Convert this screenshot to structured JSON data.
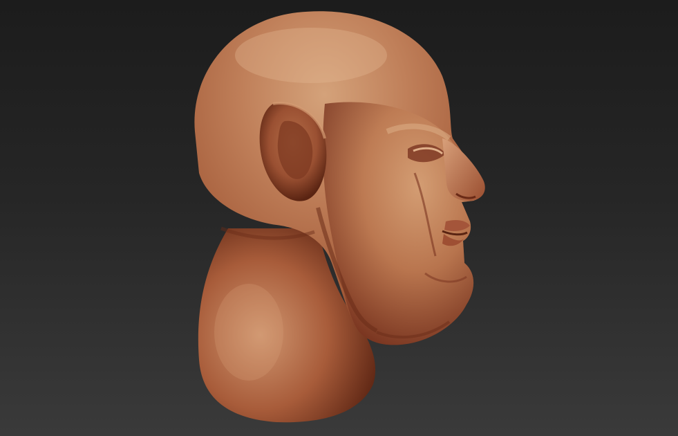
{
  "viewport": {
    "background_top": "#1c1c1c",
    "background_bottom": "#3a3a3a"
  },
  "model": {
    "subject": "head-bust-profile",
    "material_base": "#b0603e",
    "material_highlight": "#d9a57a",
    "material_shadow": "#6e2f1c"
  }
}
